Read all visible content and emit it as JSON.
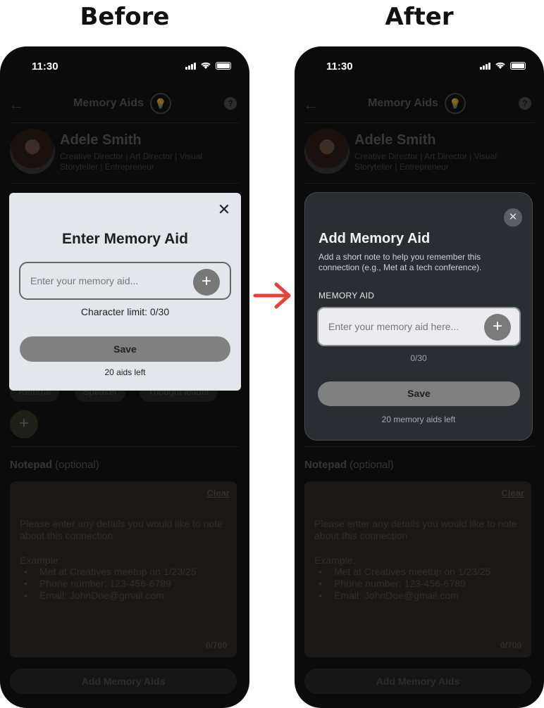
{
  "headings": {
    "before": "Before",
    "after": "After"
  },
  "status": {
    "time": "11:30"
  },
  "nav": {
    "title": "Memory Aids",
    "help": "?"
  },
  "profile": {
    "name": "Adele Smith",
    "title": "Creative Director | Art Director | Visual Storyteller | Entrepreneur"
  },
  "chips": [
    "Referral",
    "Speaker",
    "Thought leader"
  ],
  "notepad": {
    "label": "Notepad",
    "optional": "(optional)",
    "clear": "Clear",
    "intro": "Please enter any details you would like to note about this connection",
    "example_label": "Example:",
    "bullets": [
      "Met at Creatives meetup on 1/23/25",
      "Phone number: 123-456-6789",
      "Email: JohnDoe@gmail.com"
    ],
    "count": "0/700"
  },
  "bottom_button": "Add Memory Aids",
  "before_modal": {
    "title": "Enter Memory Aid",
    "placeholder": "Enter your memory aid...",
    "limit": "Character limit: 0/30",
    "save": "Save",
    "aids_left": "20 aids left"
  },
  "after_modal": {
    "title": "Add Memory Aid",
    "description": "Add a short note to help you remember this connection (e.g., Met at a tech conference).",
    "field_label": "MEMORY AID",
    "placeholder": "Enter your memory aid here...",
    "count": "0/30",
    "save": "Save",
    "aids_left": "20 memory aids left"
  },
  "colors": {
    "arrow": "#e8423a",
    "phone_bg": "#0b0b0b",
    "before_modal_bg": "#e3e7ec",
    "after_modal_bg": "#2a2e33"
  }
}
